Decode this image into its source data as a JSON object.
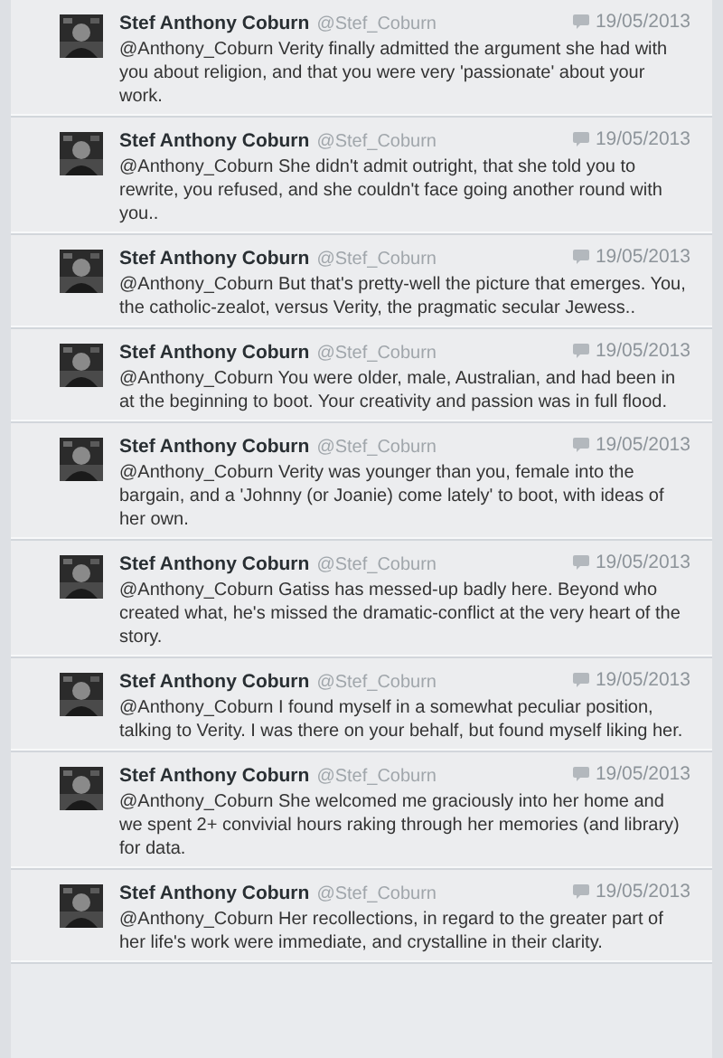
{
  "tweets": [
    {
      "name": "Stef Anthony Coburn",
      "handle": "@Stef_Coburn",
      "date": "19/05/2013",
      "text": "@Anthony_Coburn Verity finally admitted the argument she had with you about religion, and that you were very 'passionate' about your work."
    },
    {
      "name": "Stef Anthony Coburn",
      "handle": "@Stef_Coburn",
      "date": "19/05/2013",
      "text": "@Anthony_Coburn She didn't admit outright, that she told you to rewrite, you refused, and she couldn't face going another round with you.."
    },
    {
      "name": "Stef Anthony Coburn",
      "handle": "@Stef_Coburn",
      "date": "19/05/2013",
      "text": "@Anthony_Coburn But that's pretty-well the picture that emerges. You, the catholic-zealot, versus Verity, the pragmatic secular Jewess.."
    },
    {
      "name": "Stef Anthony Coburn",
      "handle": "@Stef_Coburn",
      "date": "19/05/2013",
      "text": "@Anthony_Coburn You were older, male, Australian, and had been in at the beginning to boot. Your creativity and passion was in full flood."
    },
    {
      "name": "Stef Anthony Coburn",
      "handle": "@Stef_Coburn",
      "date": "19/05/2013",
      "text": "@Anthony_Coburn Verity was younger than you, female into the bargain, and a 'Johnny (or Joanie) come lately' to boot, with ideas of her own."
    },
    {
      "name": "Stef Anthony Coburn",
      "handle": "@Stef_Coburn",
      "date": "19/05/2013",
      "text": "@Anthony_Coburn Gatiss has messed-up badly here. Beyond who created what, he's missed the dramatic-conflict at the very heart of the story."
    },
    {
      "name": "Stef Anthony Coburn",
      "handle": "@Stef_Coburn",
      "date": "19/05/2013",
      "text": "@Anthony_Coburn I found myself in a somewhat peculiar position, talking to Verity. I was there on your behalf, but found myself liking her."
    },
    {
      "name": "Stef Anthony Coburn",
      "handle": "@Stef_Coburn",
      "date": "19/05/2013",
      "text": "@Anthony_Coburn She welcomed me graciously into her home and we spent 2+ convivial hours raking through her memories (and library) for data."
    },
    {
      "name": "Stef Anthony Coburn",
      "handle": "@Stef_Coburn",
      "date": "19/05/2013",
      "text": "@Anthony_Coburn Her recollections, in regard to the greater part of her life's work were immediate, and crystalline in their clarity."
    }
  ]
}
